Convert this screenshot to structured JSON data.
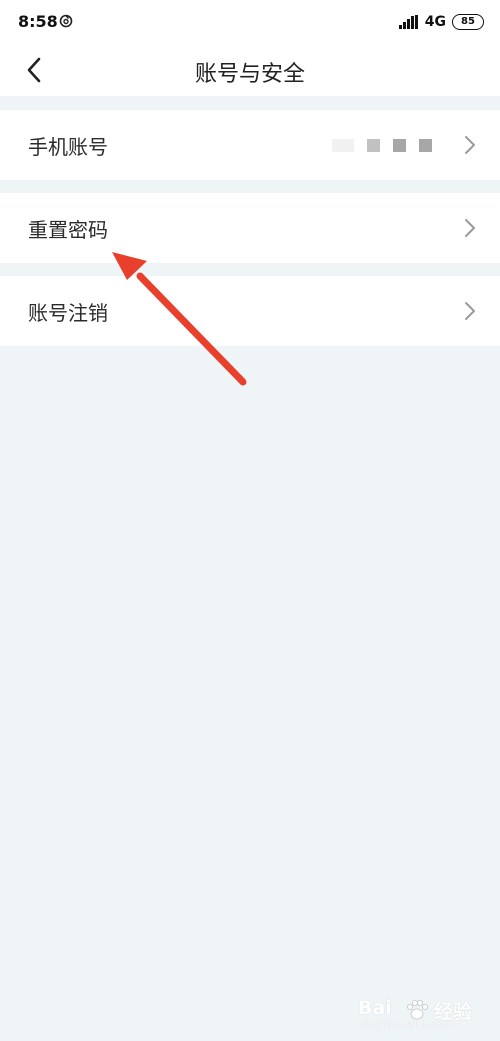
{
  "status_bar": {
    "time": "8:58",
    "network": "4G",
    "battery": "85"
  },
  "header": {
    "title": "账号与安全"
  },
  "rows": [
    {
      "label": "手机账号",
      "value_masked": true
    },
    {
      "label": "重置密码"
    },
    {
      "label": "账号注销"
    }
  ],
  "annotation": {
    "color": "#e8402c"
  },
  "icons": {
    "back": "chevron-left-icon",
    "row_chevron": "chevron-right-icon",
    "status_app": "app-notification-icon",
    "signal": "signal-strength-icon",
    "watermark": "baidu-paw-icon"
  },
  "watermark": {
    "brand": "Bai",
    "brand_cn": "经验",
    "url": "jingyan.baidu.com"
  },
  "colors": {
    "background": "#eff4f7",
    "surface": "#ffffff",
    "text": "#2b2b2b",
    "chevron": "#9a9a9a"
  }
}
